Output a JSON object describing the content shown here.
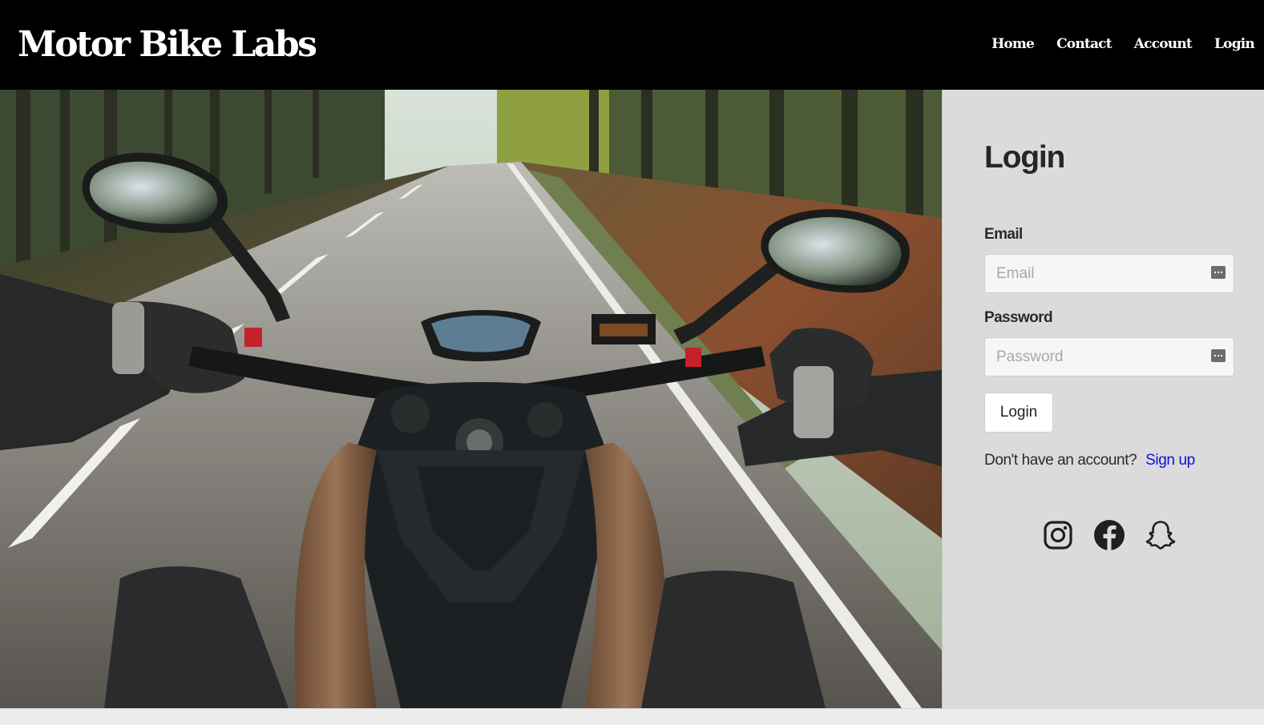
{
  "header": {
    "brand": "Motor Bike Labs",
    "nav": [
      "Home",
      "Contact",
      "Account",
      "Login"
    ]
  },
  "hero": {
    "description": "First-person view from a motorcycle riding on a forest road"
  },
  "login": {
    "title": "Login",
    "email_label": "Email",
    "email_placeholder": "Email",
    "password_label": "Password",
    "password_placeholder": "Password",
    "submit_label": "Login",
    "signup_prompt": "Don't have an account?",
    "signup_link": "Sign up"
  },
  "social": {
    "icons": [
      "instagram-icon",
      "facebook-icon",
      "snapchat-icon"
    ]
  },
  "colors": {
    "header_bg": "#000000",
    "panel_bg": "#dcdbdb",
    "link": "#0a12d8",
    "text": "#262626"
  }
}
